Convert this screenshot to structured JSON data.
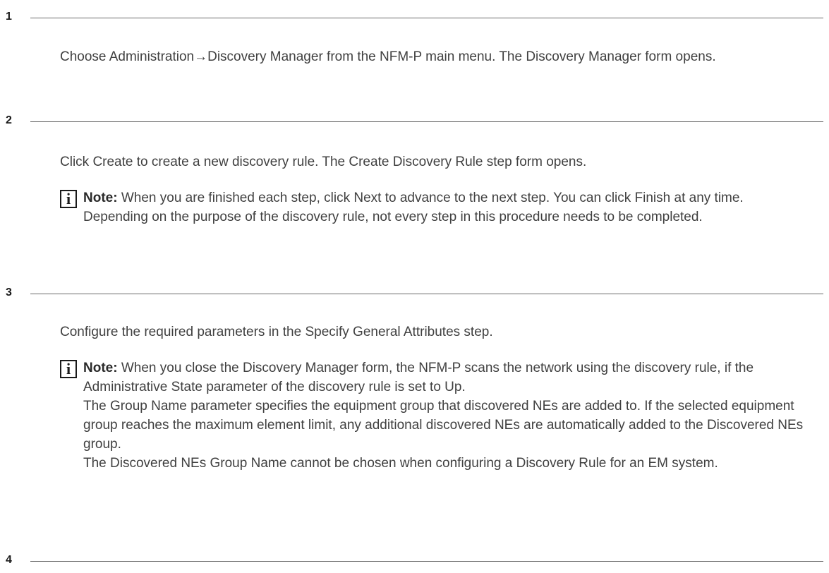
{
  "steps": [
    {
      "number": "1",
      "text": "Choose Administration→Discovery Manager from the NFM-P main menu. The Discovery Manager form opens."
    },
    {
      "number": "2",
      "text": "Click Create to create a new discovery rule. The Create Discovery Rule step form opens.",
      "note": {
        "label": "Note:",
        "first": "When you are finished each step, click Next to advance to the next step. You can click Finish at any time.",
        "second": "Depending on the purpose of the discovery rule, not every step in this procedure needs to be completed."
      }
    },
    {
      "number": "3",
      "text": "Configure the required parameters in the Specify General Attributes step.",
      "note": {
        "label": "Note:",
        "first": "When you close the Discovery Manager form, the NFM-P scans the network using the discovery rule, if the Administrative State parameter of the discovery rule is set to Up.",
        "second": "The Group Name parameter specifies the equipment group that discovered NEs are added to. If the selected equipment group reaches the maximum element limit, any additional discovered NEs are automatically added to the Discovered NEs group.",
        "third": "The Discovered NEs Group Name cannot be chosen when configuring a Discovery Rule for an EM system."
      }
    },
    {
      "number": "4"
    }
  ],
  "icons": {
    "note_icon": "info-icon",
    "note_glyph": "i"
  }
}
